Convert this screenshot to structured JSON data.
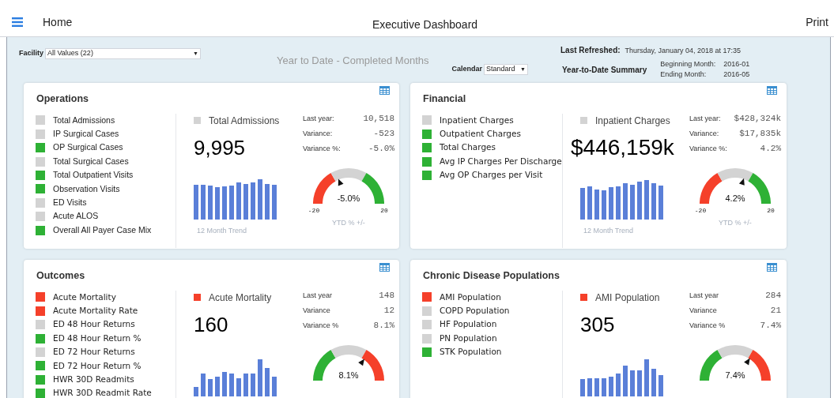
{
  "header": {
    "home": "Home",
    "title": "Executive Dashboard",
    "print": "Print"
  },
  "filters": {
    "facility": {
      "label": "Facility",
      "value": "All Values (22)",
      "arrow": "▼"
    },
    "period_heading": "Year to Date - Completed Months",
    "calendar": {
      "label": "Calendar",
      "value": "Standard",
      "arrow": "▼"
    }
  },
  "refresh": {
    "label": "Last Refreshed:",
    "value": "Thursday, January 04, 2018 at 17:35"
  },
  "summary": {
    "label": "Year-to-Date Summary",
    "beginning_label": "Beginning Month:",
    "beginning_value": "2016-01",
    "ending_label": "Ending Month:",
    "ending_value": "2016-05"
  },
  "cards": [
    {
      "title": "Operations",
      "metrics": [
        {
          "label": "Total Admissions",
          "color": "#d3d3d3"
        },
        {
          "label": "IP Surgical Cases",
          "color": "#d3d3d3"
        },
        {
          "label": "OP Surgical Cases",
          "color": "#2eb135"
        },
        {
          "label": "Total Surgical Cases",
          "color": "#d3d3d3"
        },
        {
          "label": "Total Outpatient Visits",
          "color": "#2eb135"
        },
        {
          "label": "Observation Visits",
          "color": "#2eb135"
        },
        {
          "label": "ED Visits",
          "color": "#d3d3d3"
        },
        {
          "label": "Acute ALOS",
          "color": "#d3d3d3"
        },
        {
          "label": "Overall All Payer Case Mix",
          "color": "#2eb135"
        }
      ],
      "focus": {
        "label": "Total Admissions",
        "color": "#d3d3d3",
        "value": "9,995",
        "stats": [
          {
            "label": "Last year:",
            "value": "10,518"
          },
          {
            "label": "Variance:",
            "value": "-523"
          },
          {
            "label": "Variance %:",
            "value": "-5.0%"
          }
        ],
        "gauge": {
          "value": "-5.0%",
          "min": "-20",
          "max": "20",
          "level": 0.375,
          "higher_is_better": true
        },
        "trend_caption": "12 Month Trend",
        "gauge_caption": "YTD % +/-"
      }
    },
    {
      "title": "Financial",
      "metrics": [
        {
          "label": "Inpatient Charges",
          "color": "#d3d3d3"
        },
        {
          "label": "Outpatient Charges",
          "color": "#2eb135"
        },
        {
          "label": "Total Charges",
          "color": "#2eb135"
        },
        {
          "label": "Avg IP Charges Per Discharge",
          "color": "#2eb135"
        },
        {
          "label": "Avg OP Charges per Visit",
          "color": "#2eb135"
        }
      ],
      "focus": {
        "label": "Inpatient Charges",
        "color": "#d3d3d3",
        "value": "$446,159k",
        "stats": [
          {
            "label": "Last year:",
            "value": "$428,324k"
          },
          {
            "label": "Variance:",
            "value": "$17,835k"
          },
          {
            "label": "Variance %:",
            "value": "4.2%"
          }
        ],
        "gauge": {
          "value": "4.2%",
          "min": "-20",
          "max": "20",
          "level": 0.605,
          "higher_is_better": true
        },
        "trend_caption": "12 Month Trend",
        "gauge_caption": "YTD % +/-"
      }
    },
    {
      "title": "Outcomes",
      "metrics": [
        {
          "label": "Acute Mortality",
          "color": "#f5402a"
        },
        {
          "label": "Acute Mortality Rate",
          "color": "#f5402a"
        },
        {
          "label": "ED 48 Hour Returns",
          "color": "#d3d3d3"
        },
        {
          "label": "ED 48 Hour Return %",
          "color": "#2eb135"
        },
        {
          "label": "ED 72 Hour Returns",
          "color": "#d3d3d3"
        },
        {
          "label": "ED 72 Hour Return %",
          "color": "#2eb135"
        },
        {
          "label": "HWR 30D Readmits",
          "color": "#2eb135"
        },
        {
          "label": "HWR 30D Readmit Rate",
          "color": "#2eb135"
        }
      ],
      "focus": {
        "label": "Acute Mortality",
        "color": "#f5402a",
        "value": "160",
        "stats": [
          {
            "label": "Last year",
            "value": "148"
          },
          {
            "label": "Variance",
            "value": "12"
          },
          {
            "label": "Variance %",
            "value": "8.1%"
          }
        ],
        "gauge": {
          "value": "8.1%",
          "level": 0.7,
          "higher_is_better": false
        }
      }
    },
    {
      "title": "Chronic Disease Populations",
      "metrics": [
        {
          "label": "AMI Population",
          "color": "#f5402a"
        },
        {
          "label": "COPD Population",
          "color": "#d3d3d3"
        },
        {
          "label": "HF Population",
          "color": "#d3d3d3"
        },
        {
          "label": "PN Population",
          "color": "#d3d3d3"
        },
        {
          "label": "STK Population",
          "color": "#2eb135"
        }
      ],
      "focus": {
        "label": "AMI Population",
        "color": "#f5402a",
        "value": "305",
        "stats": [
          {
            "label": "Last year",
            "value": "284"
          },
          {
            "label": "Variance",
            "value": "21"
          },
          {
            "label": "Variance %",
            "value": "7.4%"
          }
        ],
        "gauge": {
          "value": "7.4%",
          "level": 0.685,
          "higher_is_better": false
        }
      }
    }
  ]
}
